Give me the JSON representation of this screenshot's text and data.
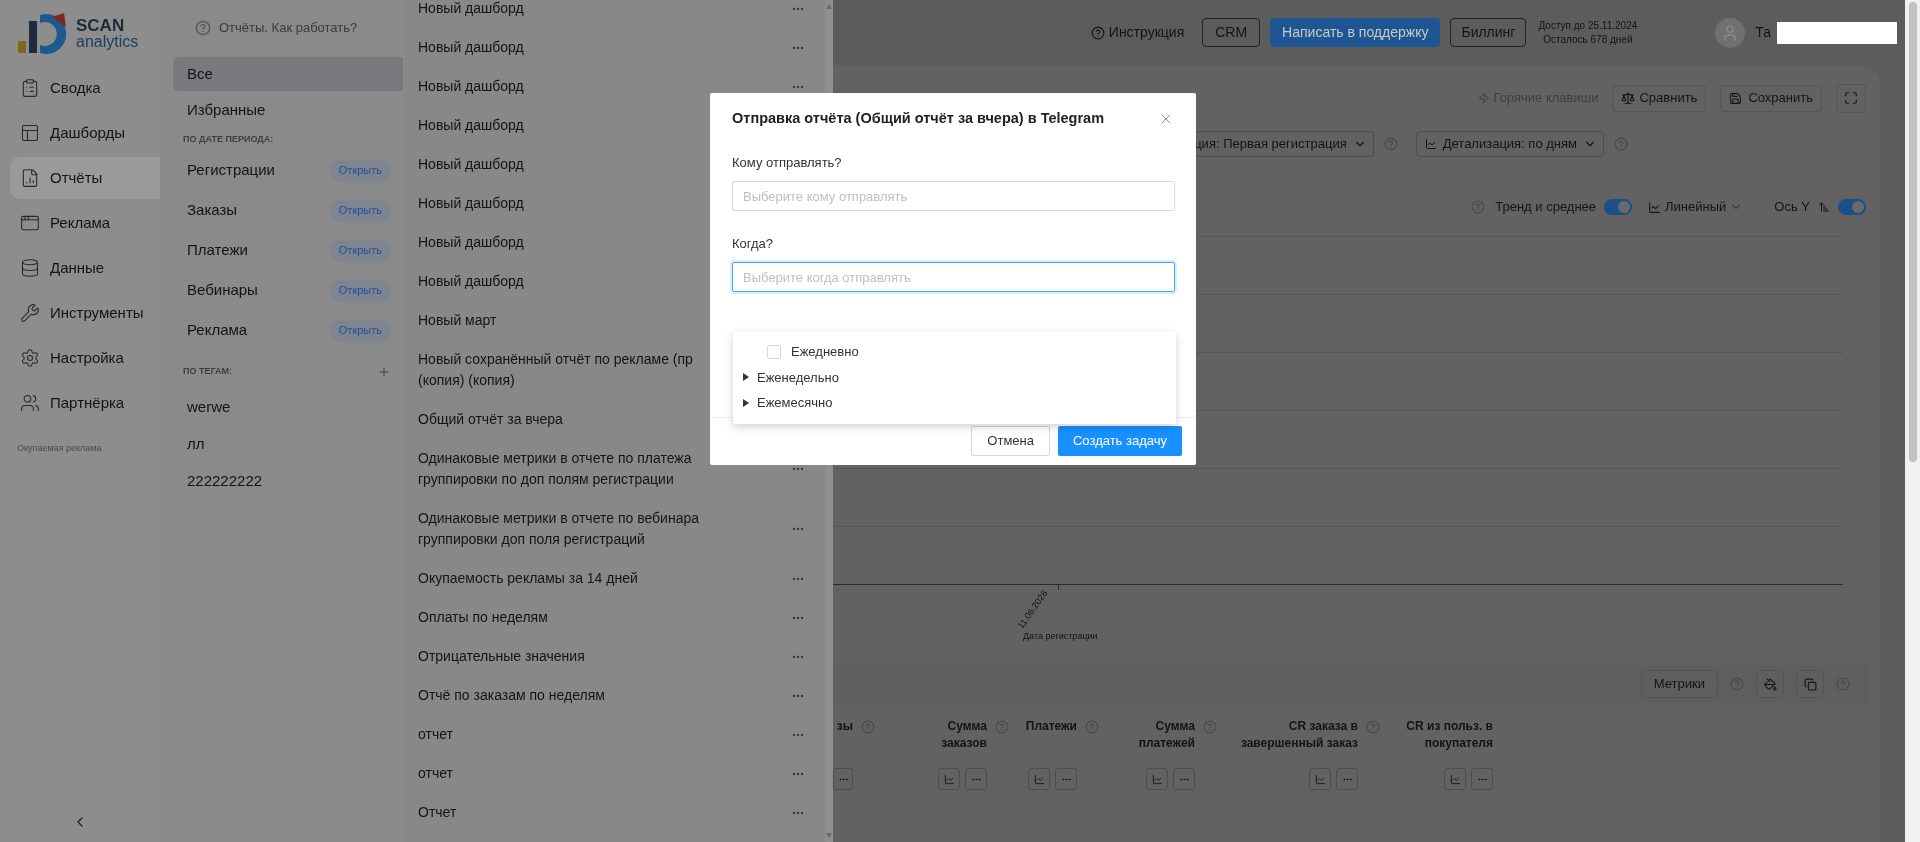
{
  "logo": {
    "title": "SCAN",
    "subtitle": "analytics"
  },
  "nav": {
    "items": [
      {
        "label": "Сводка",
        "selected": false
      },
      {
        "label": "Дашборды",
        "selected": false
      },
      {
        "label": "Отчёты",
        "selected": true
      },
      {
        "label": "Реклама",
        "selected": false
      },
      {
        "label": "Данные",
        "selected": false
      },
      {
        "label": "Инструменты",
        "selected": false
      },
      {
        "label": "Настройка",
        "selected": false
      },
      {
        "label": "Партнёрка",
        "selected": false
      }
    ],
    "footer_note": "Окупаемая реклама"
  },
  "reports_panel": {
    "help": "Отчёты. Как работать?",
    "filters": [
      {
        "label": "Все",
        "selected": true
      },
      {
        "label": "Избранные",
        "selected": false
      }
    ],
    "period_heading": "ПО ДАТЕ ПЕРИОДА:",
    "periods": [
      {
        "label": "Регистрации",
        "action": "Открыть"
      },
      {
        "label": "Заказы",
        "action": "Открыть"
      },
      {
        "label": "Платежи",
        "action": "Открыть"
      },
      {
        "label": "Вебинары",
        "action": "Открыть"
      },
      {
        "label": "Реклама",
        "action": "Открыть"
      }
    ],
    "tags_heading": "ПО ТЕГАМ:",
    "tags": [
      "werwe",
      "лл",
      "222222222"
    ]
  },
  "report_list": [
    {
      "lines": [
        "Новый дашборд"
      ]
    },
    {
      "lines": [
        "Новый дашборд"
      ]
    },
    {
      "lines": [
        "Новый дашборд"
      ]
    },
    {
      "lines": [
        "Новый дашборд"
      ]
    },
    {
      "lines": [
        "Новый дашборд"
      ]
    },
    {
      "lines": [
        "Новый дашборд"
      ]
    },
    {
      "lines": [
        "Новый дашборд"
      ]
    },
    {
      "lines": [
        "Новый дашборд"
      ]
    },
    {
      "lines": [
        "Новый март"
      ]
    },
    {
      "lines": [
        "Новый сохранённый отчёт по рекламе (пр",
        "(копия) (копия)"
      ]
    },
    {
      "lines": [
        "Общий отчёт за вчера"
      ]
    },
    {
      "lines": [
        "Одинаковые метрики в отчете по платежа",
        "группировки по доп полям регистрации"
      ]
    },
    {
      "lines": [
        "Одинаковые метрики в отчете по вебинара",
        "группировки доп поля регистраций"
      ]
    },
    {
      "lines": [
        "Окупаемость рекламы за 14 дней"
      ]
    },
    {
      "lines": [
        "Оплаты по неделям"
      ]
    },
    {
      "lines": [
        "Отрицательные значения"
      ]
    },
    {
      "lines": [
        "Отчё по заказам по неделям"
      ]
    },
    {
      "lines": [
        "отчет"
      ]
    },
    {
      "lines": [
        "отчет"
      ]
    },
    {
      "lines": [
        "Отчет"
      ]
    }
  ],
  "header": {
    "help_link": "Инструкция",
    "crm": "CRM",
    "support": "Написать в поддержку",
    "billing": "Биллинг",
    "access": "Доступ до 25.11.2024",
    "remaining": "Осталось 678 дней",
    "user": "Та"
  },
  "toolbar": {
    "hotkeys": "Горячие клавиши",
    "compare": "Сравнить",
    "save": "Сохранить"
  },
  "filters": [
    {
      "label": "ция: Первая регистрация"
    },
    {
      "label": "Детализация:  по дням"
    }
  ],
  "chart_options": {
    "trend": {
      "label": "Тренд и среднее",
      "on": true
    },
    "type": "Линейный",
    "axis": {
      "label": "Ось Y",
      "on": true
    }
  },
  "chart": {
    "x_tick": "11.06.2026",
    "x_label": "Дата регистрации"
  },
  "table": {
    "metrics_button": "Метрики",
    "columns": [
      {
        "lines": [
          "зы"
        ],
        "help": true,
        "chart": false
      },
      {
        "lines": [
          "Сумма",
          "заказов"
        ],
        "help": true,
        "chart": true
      },
      {
        "lines": [
          "Платежи"
        ],
        "help": true,
        "chart": true
      },
      {
        "lines": [
          "Сумма",
          "платежей"
        ],
        "help": true,
        "chart": true
      },
      {
        "lines": [
          "CR заказа в",
          "завершенный заказ"
        ],
        "help": true,
        "chart": true
      },
      {
        "lines": [
          "CR из польз. в",
          "покупателя"
        ],
        "help": false,
        "chart": true
      }
    ]
  },
  "modal": {
    "title": "Отправка отчёта (Общий отчёт за вчера) в Telegram",
    "fields": [
      {
        "label": "Кому отправлять?",
        "placeholder": "Выберите кому отправлять",
        "focused": false
      },
      {
        "label": "Когда?",
        "placeholder": "Выберите когда отправлять",
        "focused": true
      }
    ],
    "options": [
      {
        "kind": "checkbox",
        "label": "Ежедневно",
        "checked": false
      },
      {
        "kind": "group",
        "label": "Еженедельно",
        "expanded": false
      },
      {
        "kind": "group",
        "label": "Ежемесячно",
        "expanded": false
      }
    ],
    "cancel": "Отмена",
    "submit": "Создать задачу"
  }
}
